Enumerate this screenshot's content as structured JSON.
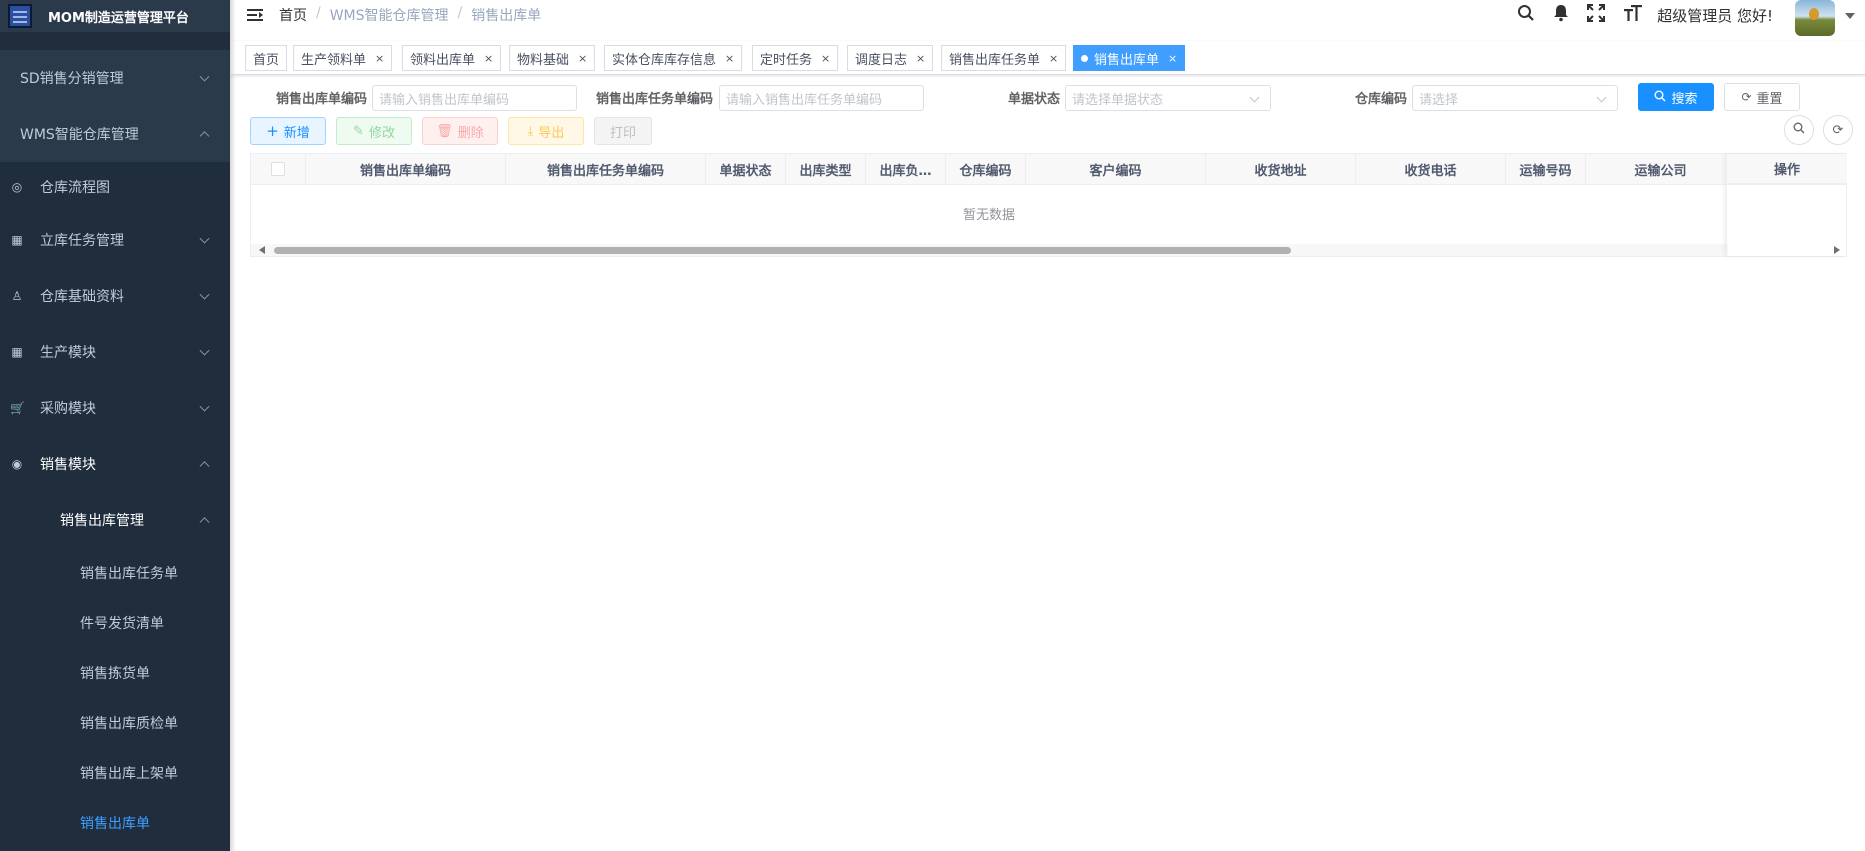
{
  "app": {
    "title": "MOM制造运营管理平台"
  },
  "sidebar": {
    "items": [
      {
        "label": "SD销售分销管理"
      },
      {
        "label": "WMS智能仓库管理"
      },
      {
        "label": "仓库流程图",
        "icon": "palette-icon"
      },
      {
        "label": "立库任务管理",
        "icon": "grid-icon"
      },
      {
        "label": "仓库基础资料",
        "icon": "people-icon"
      },
      {
        "label": "生产模块",
        "icon": "grid-icon"
      },
      {
        "label": "采购模块",
        "icon": "cart-icon"
      },
      {
        "label": "销售模块",
        "icon": "globe-icon"
      },
      {
        "label": "销售出库管理"
      },
      {
        "label": "销售出库任务单"
      },
      {
        "label": "件号发货清单"
      },
      {
        "label": "销售拣货单"
      },
      {
        "label": "销售出库质检单"
      },
      {
        "label": "销售出库上架单"
      },
      {
        "label": "销售出库单"
      }
    ]
  },
  "header": {
    "breadcrumb": [
      "首页",
      "WMS智能仓库管理",
      "销售出库单"
    ],
    "breadcrumb_sep": "/",
    "greeting": "超级管理员 您好!"
  },
  "tags": [
    {
      "label": "首页"
    },
    {
      "label": "生产领料单",
      "close": "×"
    },
    {
      "label": "领料出库单",
      "close": "×"
    },
    {
      "label": "物料基础",
      "close": "×"
    },
    {
      "label": "实体仓库库存信息",
      "close": "×"
    },
    {
      "label": "定时任务",
      "close": "×"
    },
    {
      "label": "调度日志",
      "close": "×"
    },
    {
      "label": "销售出库任务单",
      "close": "×"
    },
    {
      "label": "销售出库单",
      "close": "×",
      "active": true
    }
  ],
  "search": {
    "fields": [
      {
        "label": "销售出库单编码",
        "placeholder": "请输入销售出库单编码"
      },
      {
        "label": "销售出库任务单编码",
        "placeholder": "请输入销售出库任务单编码"
      },
      {
        "label": "单据状态",
        "placeholder": "请选择单据状态"
      },
      {
        "label": "仓库编码",
        "placeholder": "请选择"
      }
    ],
    "search_label": "搜索",
    "reset_label": "重置"
  },
  "toolbar": {
    "add": "新增",
    "edit": "修改",
    "delete": "删除",
    "export": "导出",
    "print": "打印"
  },
  "table": {
    "columns": [
      "销售出库单编码",
      "销售出库任务单编码",
      "单据状态",
      "出库类型",
      "出库负…",
      "仓库编码",
      "客户编码",
      "收货地址",
      "收货电话",
      "运输号码",
      "运输公司",
      "操作"
    ],
    "empty_text": "暂无数据"
  },
  "colors": {
    "primary": "#1890ff",
    "sidebar_bg": "#1f2d3d",
    "active_text": "#409eff"
  }
}
